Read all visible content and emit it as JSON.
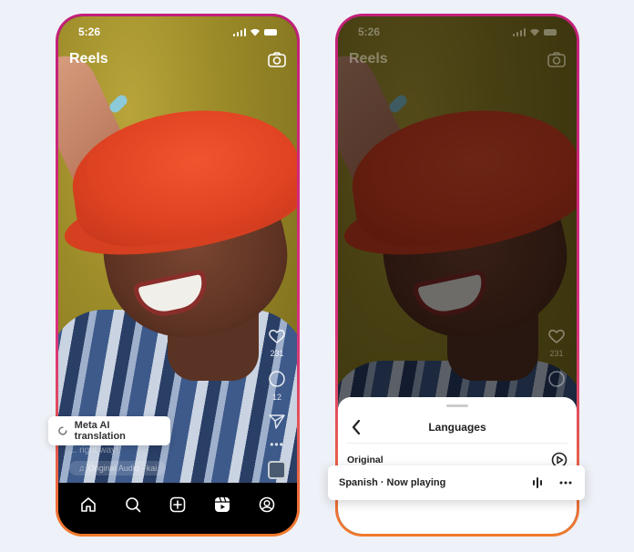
{
  "left_phone": {
    "status_time": "5:26",
    "title": "Reels",
    "camera_icon": "camera-icon",
    "rail": {
      "like_count": "231",
      "comment_count": "12"
    },
    "caption": "... right way!",
    "audio_label": "Original Audio · kai",
    "translation_pill": {
      "label": "Meta AI translation",
      "icon": "spinner-icon"
    },
    "nav": [
      {
        "name": "home",
        "icon": "home-icon"
      },
      {
        "name": "search",
        "icon": "search-icon"
      },
      {
        "name": "create",
        "icon": "plus-square-icon"
      },
      {
        "name": "reels",
        "icon": "reels-icon",
        "active": true
      },
      {
        "name": "profile",
        "icon": "profile-icon"
      }
    ]
  },
  "right_phone": {
    "status_time": "5:26",
    "title": "Reels",
    "rail": {
      "like_count": "231"
    },
    "sheet": {
      "title": "Languages",
      "back_icon": "chevron-left-icon",
      "rows": [
        {
          "label": "Original",
          "icon": "play-circle-icon"
        }
      ]
    },
    "now_playing": {
      "label": "Spanish · Now playing",
      "icons": [
        "audio-wave-icon",
        "more-icon"
      ]
    }
  },
  "colors": {
    "frame_top": "#c2207a",
    "frame_bottom": "#f07a2a",
    "background": "#eef1f7"
  }
}
